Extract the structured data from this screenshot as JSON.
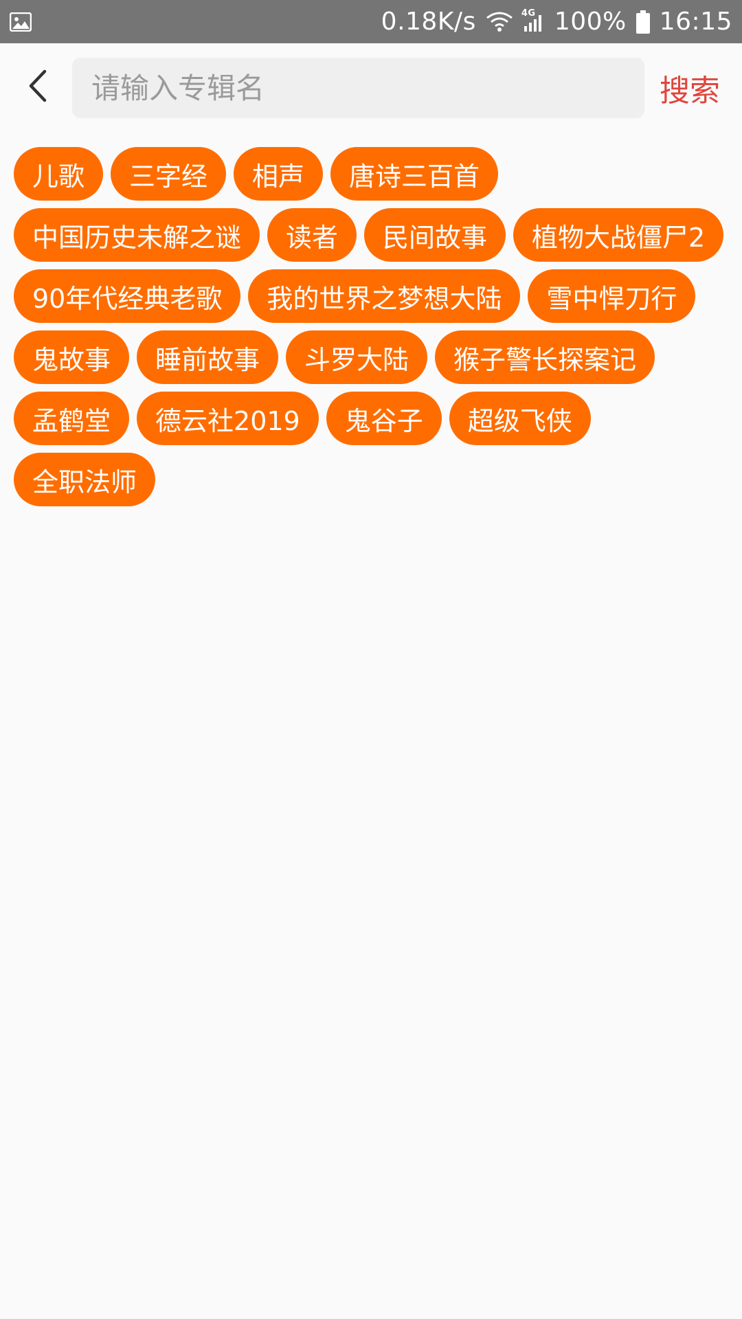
{
  "status_bar": {
    "net_speed": "0.18K/s",
    "battery": "100%",
    "time": "16:15",
    "network_type": "4G",
    "icons": [
      "gallery-icon",
      "wifi-icon",
      "signal-icon",
      "battery-icon"
    ]
  },
  "search": {
    "placeholder": "请输入专辑名",
    "value": "",
    "button_label": "搜索",
    "back_icon": "chevron-left-icon"
  },
  "tags": [
    {
      "label": "儿歌"
    },
    {
      "label": "三字经"
    },
    {
      "label": "相声"
    },
    {
      "label": "唐诗三百首"
    },
    {
      "label": "中国历史未解之谜"
    },
    {
      "label": "读者"
    },
    {
      "label": "民间故事"
    },
    {
      "label": "植物大战僵尸2"
    },
    {
      "label": "90年代经典老歌"
    },
    {
      "label": "我的世界之梦想大陆"
    },
    {
      "label": "雪中悍刀行"
    },
    {
      "label": "鬼故事"
    },
    {
      "label": "睡前故事"
    },
    {
      "label": "斗罗大陆"
    },
    {
      "label": "猴子警长探案记"
    },
    {
      "label": "孟鹤堂"
    },
    {
      "label": "德云社2019"
    },
    {
      "label": "鬼谷子"
    },
    {
      "label": "超级飞侠"
    },
    {
      "label": "全职法师"
    }
  ],
  "colors": {
    "status_bar_bg": "#757575",
    "tag_bg": "#ff6d00",
    "tag_text": "#ffffff",
    "search_button_text": "#e0453b",
    "search_box_bg": "#efefef",
    "page_bg": "#fafafa"
  }
}
